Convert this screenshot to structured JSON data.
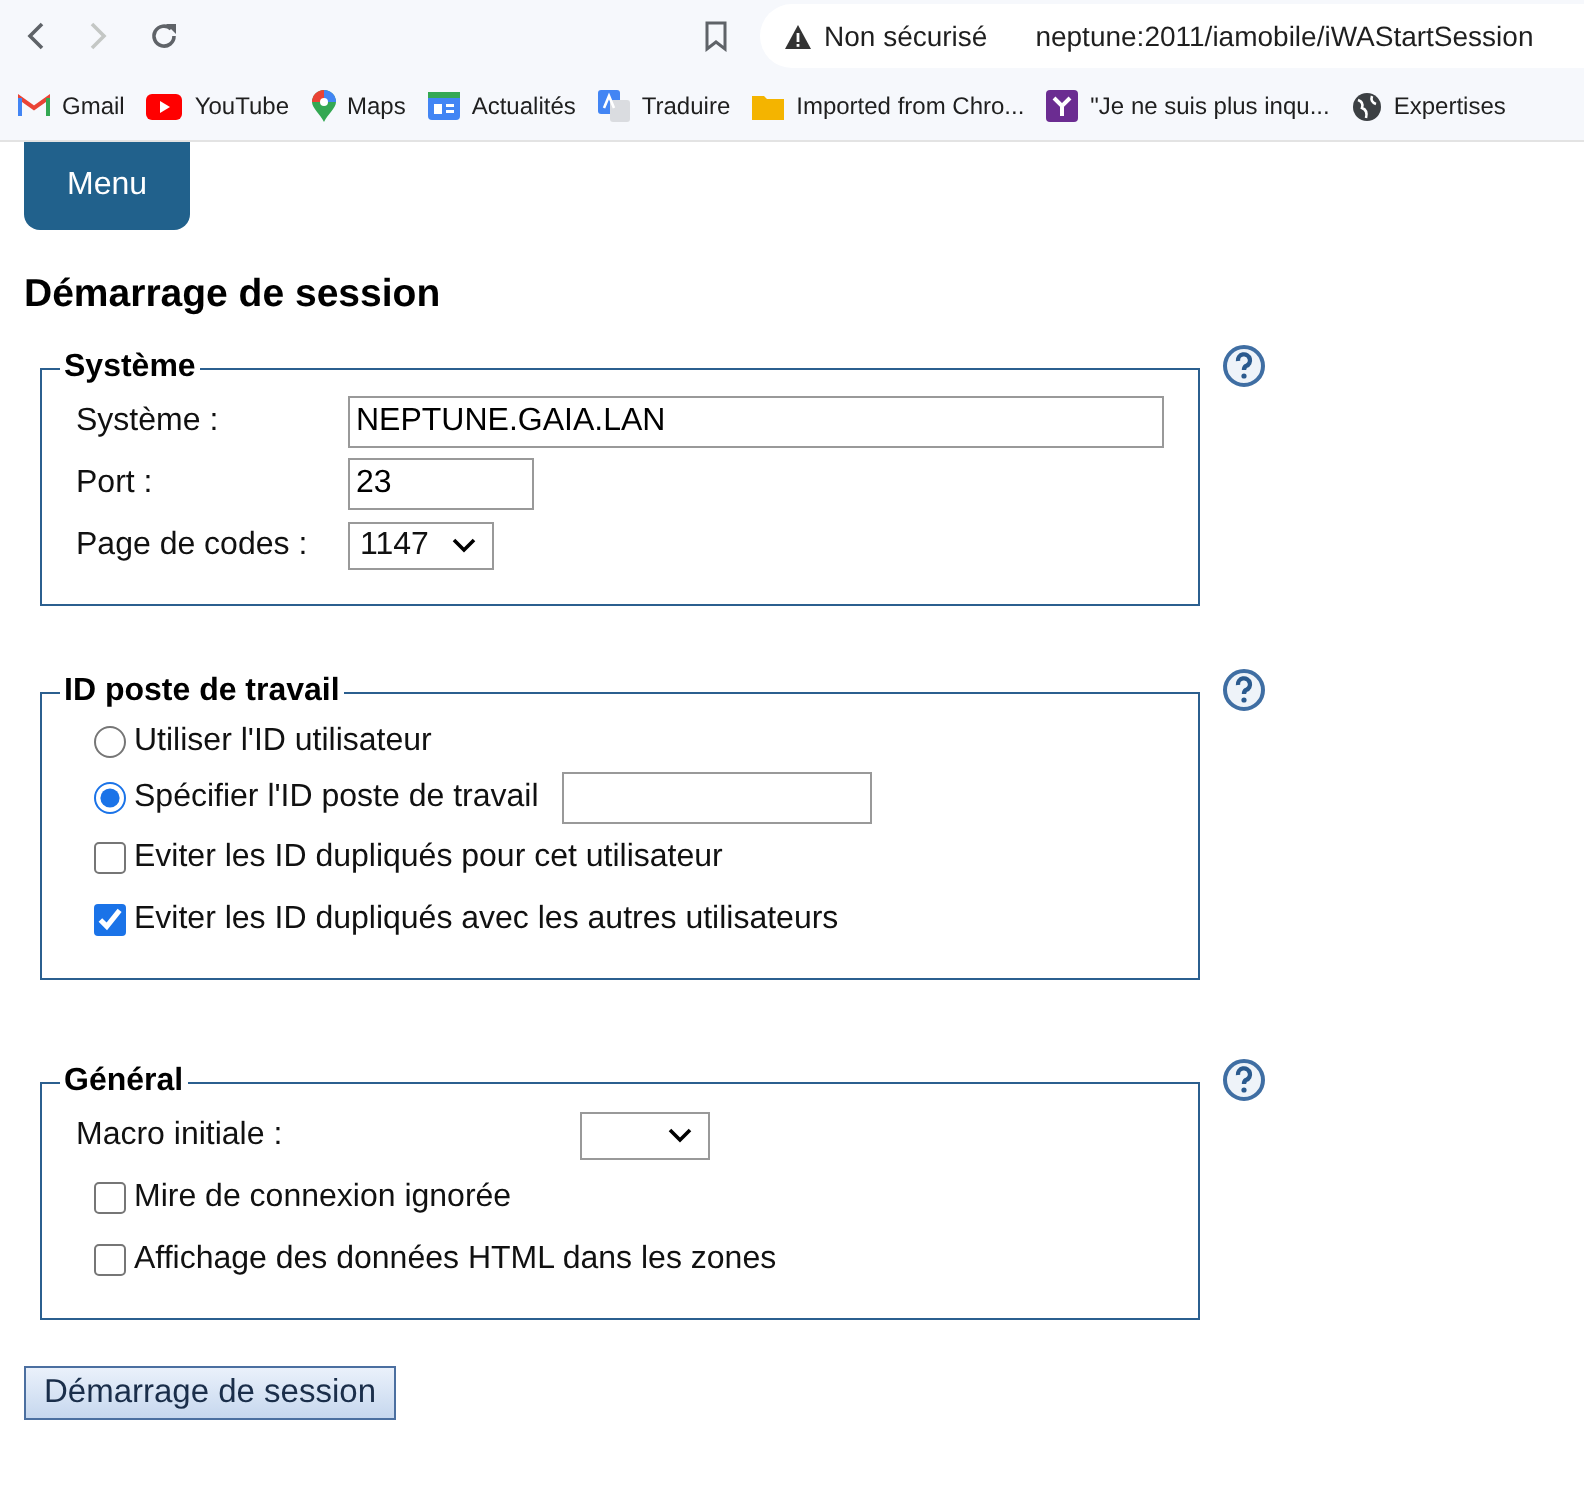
{
  "browser": {
    "security_label": "Non sécurisé",
    "url": "neptune:2011/iamobile/iWAStartSession",
    "bookmarks": [
      {
        "kind": "gmail",
        "label": "Gmail"
      },
      {
        "kind": "youtube",
        "label": "YouTube"
      },
      {
        "kind": "maps",
        "label": "Maps"
      },
      {
        "kind": "news",
        "label": "Actualités"
      },
      {
        "kind": "translate",
        "label": "Traduire"
      },
      {
        "kind": "folder",
        "label": "Imported from Chro..."
      },
      {
        "kind": "app",
        "label": "\"Je ne suis plus inqu..."
      },
      {
        "kind": "globe",
        "label": "Expertises"
      }
    ]
  },
  "menu_button": "Menu",
  "heading": "Démarrage de session",
  "sections": [
    {
      "title": "Système",
      "rows": [
        {
          "kind": "text",
          "label": "Système :",
          "value": "NEPTUNE.GAIA.LAN"
        },
        {
          "kind": "text",
          "label": "Port :",
          "value": "23"
        },
        {
          "kind": "select",
          "label": "Page de codes :",
          "value": "1147"
        }
      ]
    },
    {
      "title": "ID poste de travail",
      "rows": [
        {
          "kind": "radio",
          "label": "Utiliser l'ID utilisateur",
          "selected": false
        },
        {
          "kind": "radio-field",
          "label": "Spécifier l'ID poste de travail",
          "selected": true
        },
        {
          "kind": "checkbox",
          "label": "Eviter les ID dupliqués pour cet utilisateur",
          "checked": false
        },
        {
          "kind": "checkbox",
          "label": "Eviter les ID dupliqués avec les autres utilisateurs",
          "checked": true
        }
      ]
    },
    {
      "title": "Général",
      "rows": [
        {
          "kind": "select",
          "label": "Macro initiale :"
        },
        {
          "kind": "checkbox",
          "label": "Mire de connexion ignorée",
          "checked": false
        },
        {
          "kind": "checkbox",
          "label": "Affichage des données HTML dans les zones",
          "checked": false
        }
      ]
    }
  ],
  "submit_button": "Démarrage de session"
}
